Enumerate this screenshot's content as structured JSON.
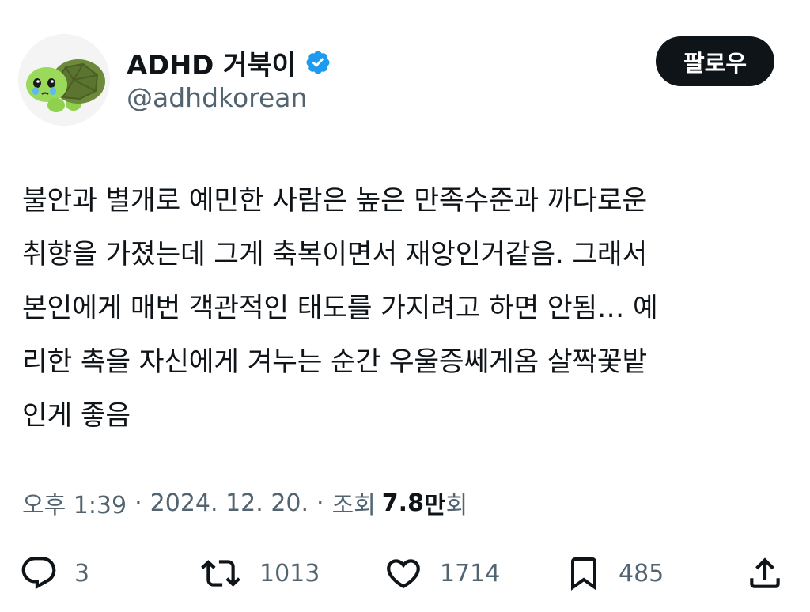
{
  "author": {
    "display_name": "ADHD 거북이",
    "handle": "@adhdkorean",
    "verified": true,
    "avatar_icon": "turtle-emoji-avatar"
  },
  "follow_button": {
    "label": "팔로우"
  },
  "tweet": {
    "lines": [
      "불안과 별개로 예민한 사람은 높은 만족수준과 까다로운",
      "취향을 가졌는데 그게 축복이면서 재앙인거같음. 그래서",
      "본인에게 매번 객관적인 태도를 가지려고 하면 안됨… 예",
      "리한 촉을 자신에게 겨누는 순간 우울증쎄게옴 살짝꽃밭",
      "인게 좋음"
    ]
  },
  "meta": {
    "time": "오후 1:39",
    "separator": "·",
    "date": "2024. 12. 20.",
    "views_label": "조회",
    "views_count": "7.8",
    "views_unit": "만",
    "views_suffix": "회"
  },
  "actions": {
    "replies": "3",
    "retweets": "1013",
    "likes": "1714",
    "bookmarks": "485"
  },
  "colors": {
    "text_primary": "#0f1419",
    "text_secondary": "#536471",
    "verified_blue": "#1d9bf0",
    "follow_bg": "#0f1419"
  }
}
